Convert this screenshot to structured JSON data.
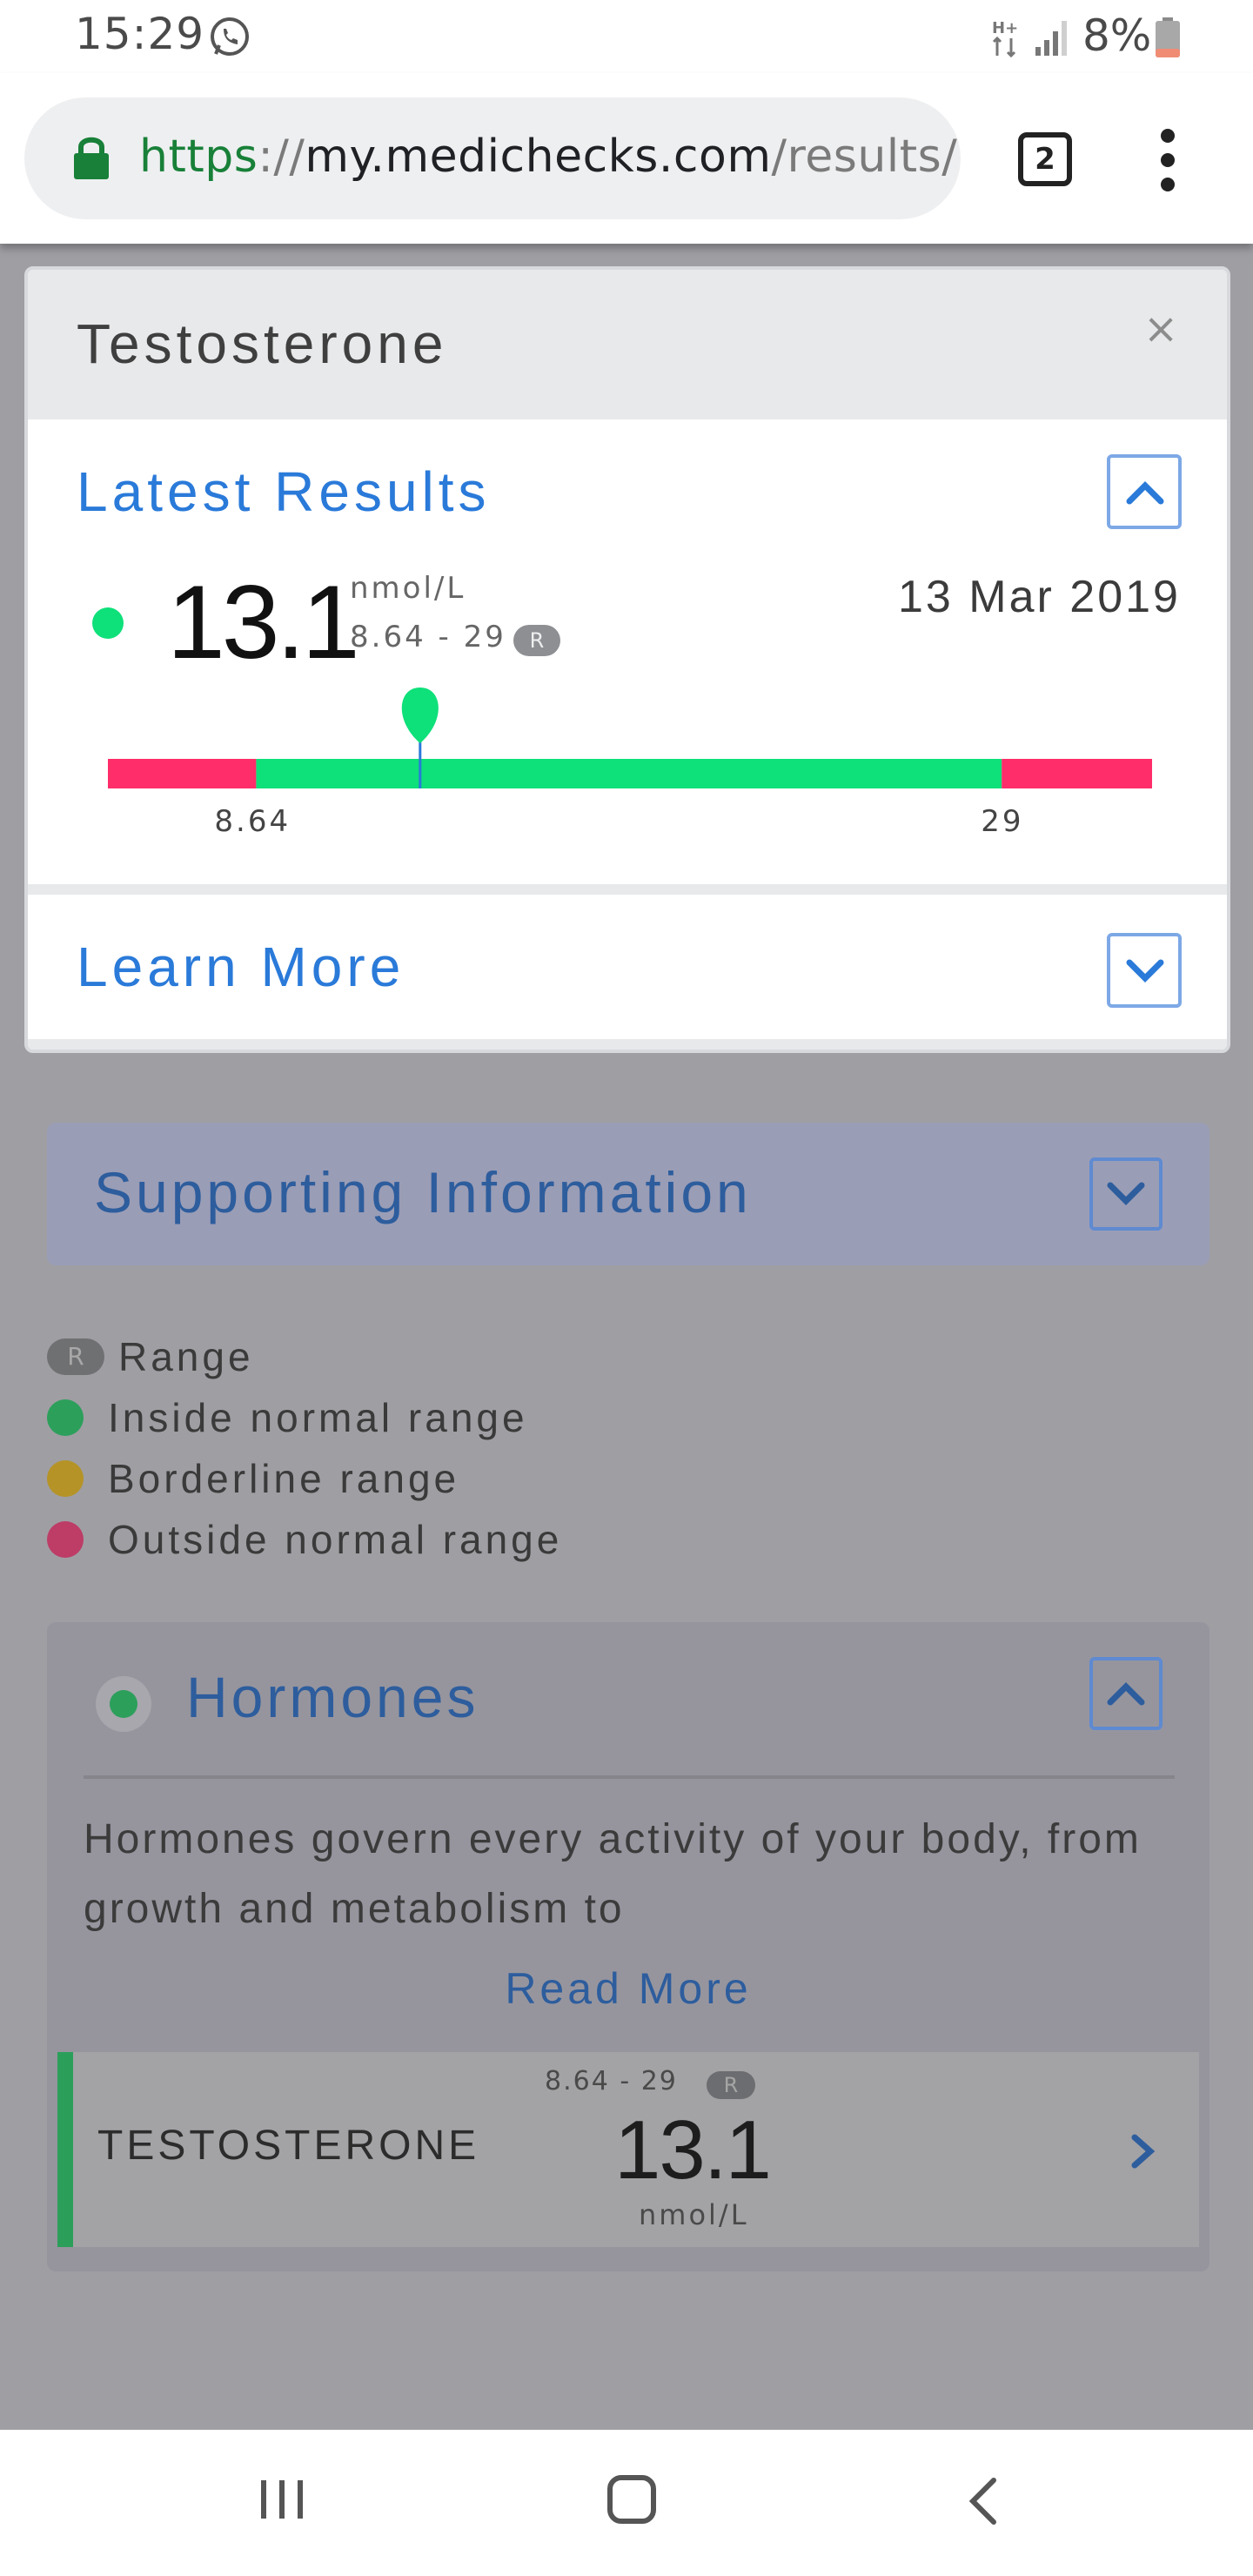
{
  "status_bar": {
    "time": "15:29",
    "battery": "8%",
    "network_indicator": "H+",
    "icons": [
      "whatsapp-icon",
      "network-icon",
      "signal-icon",
      "battery-icon"
    ]
  },
  "browser": {
    "url_scheme": "https",
    "url_separator": "://",
    "url_host": "my.medichecks.com",
    "url_path": "/results/",
    "tab_count": "2"
  },
  "modal": {
    "title": "Testosterone",
    "close_label": "×",
    "latest_results": {
      "heading": "Latest Results",
      "value": "13.1",
      "unit": "nmol/L",
      "range": "8.64 - 29",
      "range_badge": "R",
      "date": "13 Mar 2019",
      "status": "inside-normal-range"
    },
    "gauge": {
      "low": "8.64",
      "high": "29",
      "low_fraction": 0.142,
      "high_fraction": 0.856,
      "marker_fraction": 0.299
    },
    "learn_more": "Learn More"
  },
  "page": {
    "supporting_information": "Supporting Information",
    "legend": [
      {
        "badge": "R",
        "label": "Range"
      },
      {
        "label": "Inside normal range",
        "color": "#2c9f5b"
      },
      {
        "label": "Borderline range",
        "color": "#b59326"
      },
      {
        "label": "Outside normal range",
        "color": "#bd3d67"
      }
    ],
    "hormones": {
      "title": "Hormones",
      "description": "Hormones govern every activity of your body, from growth and metabolism to",
      "read_more": "Read More",
      "test": {
        "name": "TESTOSTERONE",
        "range": "8.64 - 29",
        "range_badge": "R",
        "value": "13.1",
        "unit": "nmol/L"
      }
    }
  },
  "colors": {
    "accent_blue": "#2a7ad9",
    "normal_green": "#0ee07a",
    "outside_red": "#ff2d6a"
  }
}
